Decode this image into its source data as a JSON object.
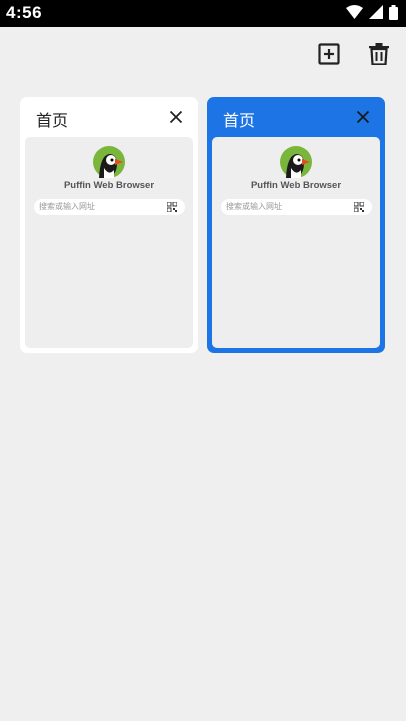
{
  "status_bar": {
    "time": "4:56",
    "icons": [
      "wifi-icon",
      "cellular-icon",
      "battery-icon"
    ]
  },
  "toolbar": {
    "new_tab_icon": "add-box-icon",
    "delete_icon": "trash-icon"
  },
  "tabs": [
    {
      "title": "首页",
      "active": false,
      "preview": {
        "brand": "Puffin Web Browser",
        "search_placeholder": "搜索或输入网址"
      }
    },
    {
      "title": "首页",
      "active": true,
      "preview": {
        "brand": "Puffin Web Browser",
        "search_placeholder": "搜索或输入网址"
      }
    }
  ],
  "colors": {
    "accent": "#1d74e5",
    "background": "#efefef"
  }
}
